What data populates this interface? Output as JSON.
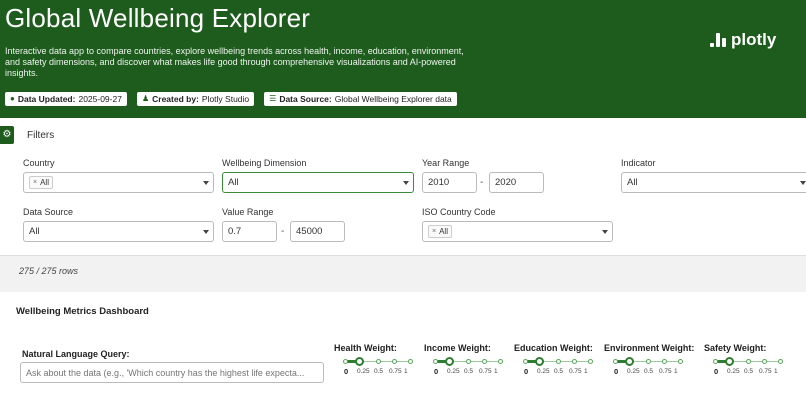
{
  "header": {
    "title": "Global Wellbeing Explorer",
    "description": "Interactive data app to compare countries, explore wellbeing trends across health, income, education, environment, and safety dimensions, and discover what makes life good through comprehensive visualizations and AI-powered insights.",
    "logo_text": "plotly",
    "badges": [
      {
        "icon": "check-circle-icon",
        "label": "Data Updated:",
        "value": "2025-09-27"
      },
      {
        "icon": "user-icon",
        "label": "Created by:",
        "value": "Plotly Studio"
      },
      {
        "icon": "database-icon",
        "label": "Data Source:",
        "value": "Global Wellbeing Explorer data"
      }
    ]
  },
  "filters": {
    "title": "Filters",
    "country": {
      "label": "Country",
      "chip": "All"
    },
    "dimension": {
      "label": "Wellbeing Dimension",
      "value": "All"
    },
    "year_range": {
      "label": "Year Range",
      "from": "2010",
      "to": "2020"
    },
    "indicator": {
      "label": "Indicator",
      "value": "All"
    },
    "data_source": {
      "label": "Data Source",
      "value": "All"
    },
    "value_range": {
      "label": "Value Range",
      "from": "0.7",
      "to": "45000"
    },
    "iso": {
      "label": "ISO Country Code",
      "chip": "All"
    },
    "range_separator": "-"
  },
  "rows_info": "275 / 275 rows",
  "dashboard": {
    "title": "Wellbeing Metrics Dashboard",
    "nlq_label": "Natural Language Query:",
    "nlq_placeholder": "Ask about the data (e.g., 'Which country has the highest life expecta...",
    "weights": [
      {
        "label": "Health Weight:",
        "value": 0.2,
        "ticks": [
          "0",
          "0.25",
          "0.5",
          "0.75",
          "1"
        ]
      },
      {
        "label": "Income Weight:",
        "value": 0.2,
        "ticks": [
          "0",
          "0.25",
          "0.5",
          "0.75",
          "1"
        ]
      },
      {
        "label": "Education Weight:",
        "value": 0.2,
        "ticks": [
          "0",
          "0.25",
          "0.5",
          "0.75",
          "1"
        ]
      },
      {
        "label": "Environment Weight:",
        "value": 0.2,
        "ticks": [
          "0",
          "0.25",
          "0.5",
          "0.75",
          "1"
        ]
      },
      {
        "label": "Safety Weight:",
        "value": 0.2,
        "ticks": [
          "0",
          "0.25",
          "0.5",
          "0.75",
          "1"
        ]
      }
    ]
  },
  "colors": {
    "brand_green": "#1e5c1e",
    "accent_green": "#2e7d32"
  }
}
